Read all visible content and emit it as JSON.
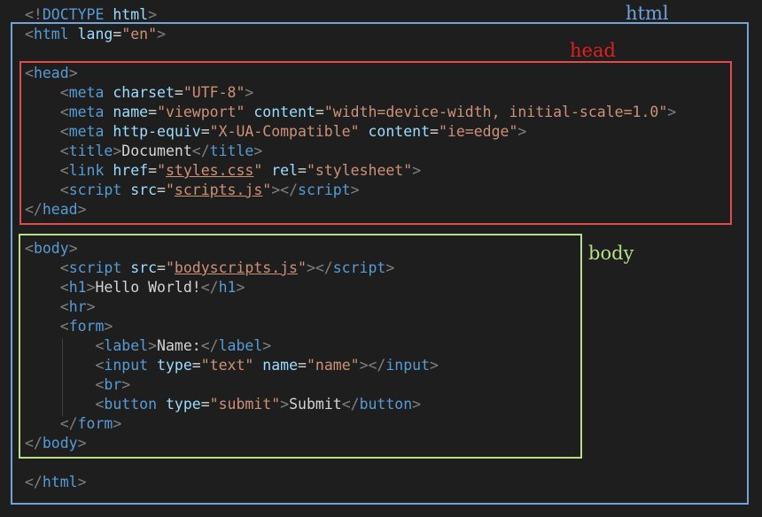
{
  "labels": {
    "html": "html",
    "head": "head",
    "body": "body"
  },
  "colors": {
    "html_box": "#6fa3d9",
    "head_box": "#e04c4c",
    "body_box": "#b9de86",
    "background": "#1e1e1e"
  },
  "code": [
    [
      [
        "punct",
        "<!"
      ],
      [
        "tag",
        "DOCTYPE"
      ],
      [
        "txt",
        " "
      ],
      [
        "attr",
        "html"
      ],
      [
        "punct",
        ">"
      ]
    ],
    [
      [
        "punct",
        "<"
      ],
      [
        "tag",
        "html"
      ],
      [
        "txt",
        " "
      ],
      [
        "attr",
        "lang"
      ],
      [
        "txt",
        "="
      ],
      [
        "val",
        "\"en\""
      ],
      [
        "punct",
        ">"
      ]
    ],
    [],
    [
      [
        "punct",
        "<"
      ],
      [
        "tag",
        "head"
      ],
      [
        "punct",
        ">"
      ]
    ],
    [
      [
        "txt",
        "    "
      ],
      [
        "punct",
        "<"
      ],
      [
        "tag",
        "meta"
      ],
      [
        "txt",
        " "
      ],
      [
        "attr",
        "charset"
      ],
      [
        "txt",
        "="
      ],
      [
        "val",
        "\"UTF-8\""
      ],
      [
        "punct",
        ">"
      ]
    ],
    [
      [
        "txt",
        "    "
      ],
      [
        "punct",
        "<"
      ],
      [
        "tag",
        "meta"
      ],
      [
        "txt",
        " "
      ],
      [
        "attr",
        "name"
      ],
      [
        "txt",
        "="
      ],
      [
        "val",
        "\"viewport\""
      ],
      [
        "txt",
        " "
      ],
      [
        "attr",
        "content"
      ],
      [
        "txt",
        "="
      ],
      [
        "val",
        "\"width=device-width, initial-scale=1.0\""
      ],
      [
        "punct",
        ">"
      ]
    ],
    [
      [
        "txt",
        "    "
      ],
      [
        "punct",
        "<"
      ],
      [
        "tag",
        "meta"
      ],
      [
        "txt",
        " "
      ],
      [
        "attr",
        "http-equiv"
      ],
      [
        "txt",
        "="
      ],
      [
        "val",
        "\"X-UA-Compatible\""
      ],
      [
        "txt",
        " "
      ],
      [
        "attr",
        "content"
      ],
      [
        "txt",
        "="
      ],
      [
        "val",
        "\"ie=edge\""
      ],
      [
        "punct",
        ">"
      ]
    ],
    [
      [
        "txt",
        "    "
      ],
      [
        "punct",
        "<"
      ],
      [
        "tag",
        "title"
      ],
      [
        "punct",
        ">"
      ],
      [
        "txt",
        "Document"
      ],
      [
        "punct",
        "</"
      ],
      [
        "tag",
        "title"
      ],
      [
        "punct",
        ">"
      ]
    ],
    [
      [
        "txt",
        "    "
      ],
      [
        "punct",
        "<"
      ],
      [
        "tag",
        "link"
      ],
      [
        "txt",
        " "
      ],
      [
        "attr",
        "href"
      ],
      [
        "txt",
        "="
      ],
      [
        "val",
        "\""
      ],
      [
        "link",
        "styles.css"
      ],
      [
        "val",
        "\""
      ],
      [
        "txt",
        " "
      ],
      [
        "attr",
        "rel"
      ],
      [
        "txt",
        "="
      ],
      [
        "val",
        "\"stylesheet\""
      ],
      [
        "punct",
        ">"
      ]
    ],
    [
      [
        "txt",
        "    "
      ],
      [
        "punct",
        "<"
      ],
      [
        "tag",
        "script"
      ],
      [
        "txt",
        " "
      ],
      [
        "attr",
        "src"
      ],
      [
        "txt",
        "="
      ],
      [
        "val",
        "\""
      ],
      [
        "link",
        "scripts.js"
      ],
      [
        "val",
        "\""
      ],
      [
        "punct",
        "></"
      ],
      [
        "tag",
        "script"
      ],
      [
        "punct",
        ">"
      ]
    ],
    [
      [
        "punct",
        "</"
      ],
      [
        "tag",
        "head"
      ],
      [
        "punct",
        ">"
      ]
    ],
    [],
    [
      [
        "punct",
        "<"
      ],
      [
        "tag",
        "body"
      ],
      [
        "punct",
        ">"
      ]
    ],
    [
      [
        "txt",
        "    "
      ],
      [
        "punct",
        "<"
      ],
      [
        "tag",
        "script"
      ],
      [
        "txt",
        " "
      ],
      [
        "attr",
        "src"
      ],
      [
        "txt",
        "="
      ],
      [
        "val",
        "\""
      ],
      [
        "link",
        "bodyscripts.js"
      ],
      [
        "val",
        "\""
      ],
      [
        "punct",
        "></"
      ],
      [
        "tag",
        "script"
      ],
      [
        "punct",
        ">"
      ]
    ],
    [
      [
        "txt",
        "    "
      ],
      [
        "punct",
        "<"
      ],
      [
        "tag",
        "h1"
      ],
      [
        "punct",
        ">"
      ],
      [
        "txt",
        "Hello World!"
      ],
      [
        "punct",
        "</"
      ],
      [
        "tag",
        "h1"
      ],
      [
        "punct",
        ">"
      ]
    ],
    [
      [
        "txt",
        "    "
      ],
      [
        "punct",
        "<"
      ],
      [
        "tag",
        "hr"
      ],
      [
        "punct",
        ">"
      ]
    ],
    [
      [
        "txt",
        "    "
      ],
      [
        "punct",
        "<"
      ],
      [
        "tag",
        "form"
      ],
      [
        "punct",
        ">"
      ]
    ],
    [
      [
        "txt",
        "        "
      ],
      [
        "punct",
        "<"
      ],
      [
        "tag",
        "label"
      ],
      [
        "punct",
        ">"
      ],
      [
        "txt",
        "Name:"
      ],
      [
        "punct",
        "</"
      ],
      [
        "tag",
        "label"
      ],
      [
        "punct",
        ">"
      ]
    ],
    [
      [
        "txt",
        "        "
      ],
      [
        "punct",
        "<"
      ],
      [
        "tag",
        "input"
      ],
      [
        "txt",
        " "
      ],
      [
        "attr",
        "type"
      ],
      [
        "txt",
        "="
      ],
      [
        "val",
        "\"text\""
      ],
      [
        "txt",
        " "
      ],
      [
        "attr",
        "name"
      ],
      [
        "txt",
        "="
      ],
      [
        "val",
        "\"name\""
      ],
      [
        "punct",
        "></"
      ],
      [
        "tag",
        "input"
      ],
      [
        "punct",
        ">"
      ]
    ],
    [
      [
        "txt",
        "        "
      ],
      [
        "punct",
        "<"
      ],
      [
        "tag",
        "br"
      ],
      [
        "punct",
        ">"
      ]
    ],
    [
      [
        "txt",
        "        "
      ],
      [
        "punct",
        "<"
      ],
      [
        "tag",
        "button"
      ],
      [
        "txt",
        " "
      ],
      [
        "attr",
        "type"
      ],
      [
        "txt",
        "="
      ],
      [
        "val",
        "\"submit\""
      ],
      [
        "punct",
        ">"
      ],
      [
        "txt",
        "Submit"
      ],
      [
        "punct",
        "</"
      ],
      [
        "tag",
        "button"
      ],
      [
        "punct",
        ">"
      ]
    ],
    [
      [
        "txt",
        "    "
      ],
      [
        "punct",
        "</"
      ],
      [
        "tag",
        "form"
      ],
      [
        "punct",
        ">"
      ]
    ],
    [
      [
        "punct",
        "</"
      ],
      [
        "tag",
        "body"
      ],
      [
        "punct",
        ">"
      ]
    ],
    [],
    [
      [
        "punct",
        "</"
      ],
      [
        "tag",
        "html"
      ],
      [
        "punct",
        ">"
      ]
    ]
  ]
}
